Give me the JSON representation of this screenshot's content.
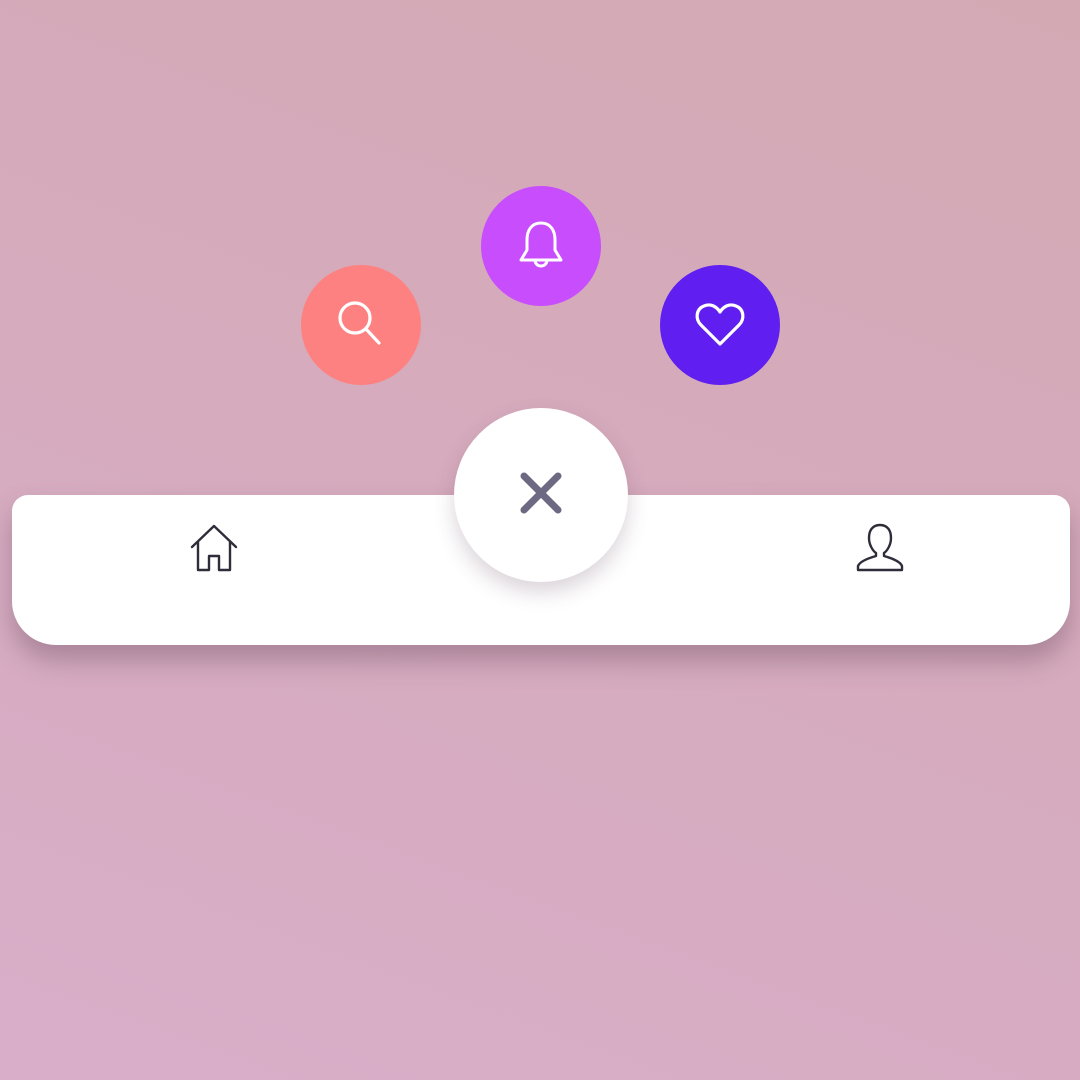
{
  "colors": {
    "background_start": "#d8aec9",
    "background_end": "#d3aab4",
    "search_button": "#fe8181",
    "bell_button": "#c84dfc",
    "heart_button": "#601ff0",
    "navbar": "#ffffff",
    "close_icon": "#6d6982",
    "nav_icon": "#2e2e3a"
  },
  "floating_actions": [
    {
      "icon": "search-icon"
    },
    {
      "icon": "bell-icon"
    },
    {
      "icon": "heart-icon"
    }
  ],
  "center_button": {
    "icon": "close-icon"
  },
  "navbar": {
    "items": [
      {
        "icon": "home-icon"
      },
      {
        "icon": "user-icon"
      }
    ]
  }
}
